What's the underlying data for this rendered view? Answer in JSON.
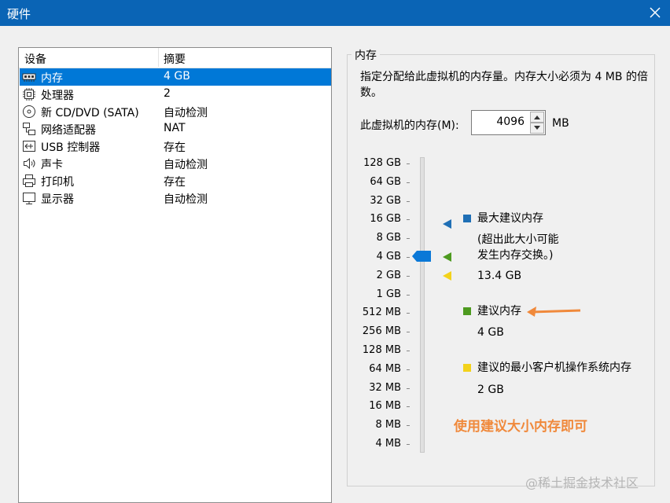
{
  "window": {
    "title": "硬件"
  },
  "devices": {
    "header": {
      "device": "设备",
      "summary": "摘要"
    },
    "rows": [
      {
        "name": "内存",
        "summary": "4 GB",
        "icon": "memory-icon",
        "selected": true
      },
      {
        "name": "处理器",
        "summary": "2",
        "icon": "processor-icon"
      },
      {
        "name": "新 CD/DVD (SATA)",
        "summary": "自动检测",
        "icon": "cd-dvd-icon"
      },
      {
        "name": "网络适配器",
        "summary": "NAT",
        "icon": "network-adapter-icon"
      },
      {
        "name": "USB 控制器",
        "summary": "存在",
        "icon": "usb-controller-icon"
      },
      {
        "name": "声卡",
        "summary": "自动检测",
        "icon": "sound-card-icon"
      },
      {
        "name": "打印机",
        "summary": "存在",
        "icon": "printer-icon"
      },
      {
        "name": "显示器",
        "summary": "自动检测",
        "icon": "display-icon"
      }
    ]
  },
  "memory": {
    "group_title": "内存",
    "description": "指定分配给此虚拟机的内存量。内存大小必须为 4 MB 的倍数。",
    "field_label": "此虚拟机的内存(M):",
    "value": "4096",
    "unit": "MB",
    "scale": [
      "128 GB",
      "64 GB",
      "32 GB",
      "16 GB",
      "8 GB",
      "4 GB",
      "2 GB",
      "1 GB",
      "512 MB",
      "256 MB",
      "128 MB",
      "64 MB",
      "32 MB",
      "16 MB",
      "8 MB",
      "4 MB"
    ],
    "current_level": "4 GB",
    "legend": {
      "max": {
        "label": "最大建议内存",
        "note_line1": "(超出此大小可能",
        "note_line2": "发生内存交换。)",
        "value": "13.4 GB",
        "color": "#1f6fb5"
      },
      "recommended": {
        "label": "建议内存",
        "value": "4 GB",
        "color": "#4d9a1f"
      },
      "min": {
        "label": "建议的最小客户机操作系统内存",
        "value": "2 GB",
        "color": "#f3d21b"
      }
    }
  },
  "annotation": {
    "note": "使用建议大小内存即可",
    "color": "#f0893b"
  },
  "watermark": "@稀土掘金技术社区"
}
